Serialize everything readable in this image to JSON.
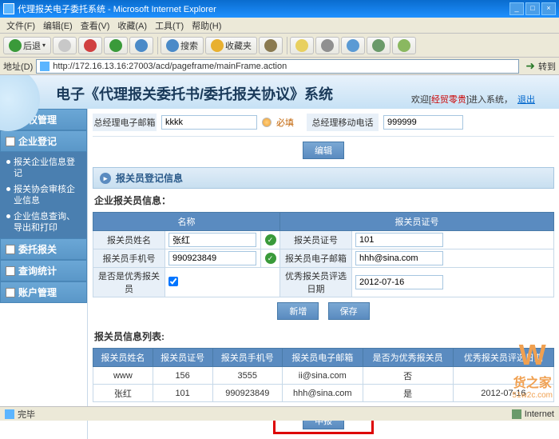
{
  "window": {
    "title": "代理报关电子委托系统 - Microsoft Internet Explorer"
  },
  "menu": {
    "file": "文件(F)",
    "edit": "编辑(E)",
    "view": "查看(V)",
    "fav": "收藏(A)",
    "tool": "工具(T)",
    "help": "帮助(H)"
  },
  "toolbar": {
    "back": "后退",
    "search": "搜索",
    "fav": "收藏夹"
  },
  "addr": {
    "label": "地址(D)",
    "url": "http://172.16.13.16:27003/acd/pageframe/mainFrame.action",
    "go": "转到"
  },
  "banner": {
    "title": "电子《代理报关委托书/委托报关协议》系统",
    "welcome": "欢迎[",
    "user": "经贸零贵",
    "welcome2": "]进入系统，",
    "logout": "退出"
  },
  "nav": {
    "auth": "授权管理",
    "reg": "企业登记",
    "delegate": "委托报关",
    "stats": "查询统计",
    "account": "账户管理",
    "sub": [
      "报关企业信息登记",
      "报关协会审核企业信息",
      "企业信息查询、导出和打印"
    ]
  },
  "form": {
    "emailLbl": "总经理电子邮箱",
    "emailVal": "kkkk",
    "req": "必填",
    "mobileLbl": "总经理移动电话",
    "mobileVal": "999999",
    "editBtn": "编辑"
  },
  "section": {
    "title": "报关员登记信息",
    "info": "企业报关员信息：",
    "col1": "名称",
    "col2": "报关员证号",
    "nameLbl": "报关员姓名",
    "nameVal": "张红",
    "certVal": "101",
    "phoneLbl": "报关员手机号",
    "phoneVal": "990923849",
    "remailLbl": "报关员电子邮箱",
    "remailVal": "hhh@sina.com",
    "excLbl": "是否是优秀报关员",
    "dateLbl": "优秀报关员评选日期",
    "dateVal": "2012-07-16",
    "addBtn": "新增",
    "saveBtn": "保存"
  },
  "list": {
    "title": "报关员信息列表:",
    "h1": "报关员姓名",
    "h2": "报关员证号",
    "h3": "报关员手机号",
    "h4": "报关员电子邮箱",
    "h5": "是否为优秀报关员",
    "h6": "优秀报关员评选日期",
    "rows": [
      {
        "name": "www",
        "cert": "156",
        "phone": "3555",
        "email": "ii@sina.com",
        "exc": "否",
        "date": ""
      },
      {
        "name": "张红",
        "cert": "101",
        "phone": "990923849",
        "email": "hhh@sina.com",
        "exc": "是",
        "date": "2012-07-16"
      }
    ],
    "submit": "申报"
  },
  "status": {
    "done": "完毕",
    "zone": "Internet"
  },
  "wm": {
    "brand": "货之家",
    "site": "51w2c.com"
  }
}
